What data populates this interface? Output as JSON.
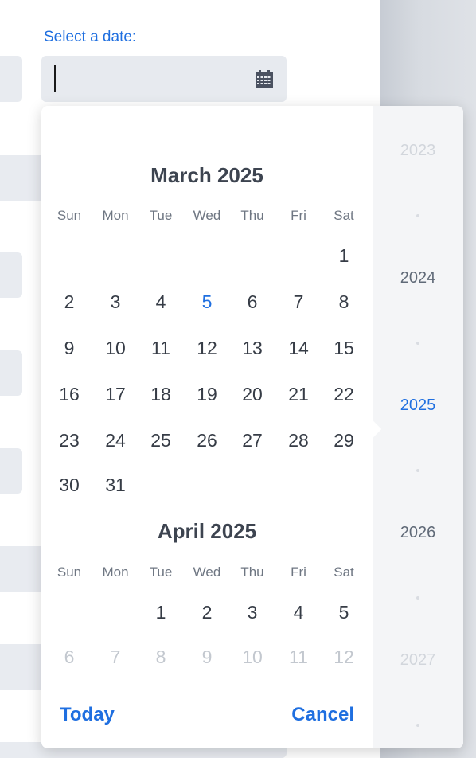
{
  "field": {
    "label": "Select a date:",
    "value": "",
    "icon": "calendar-icon"
  },
  "calendar": {
    "weekdays": [
      "Sun",
      "Mon",
      "Tue",
      "Wed",
      "Thu",
      "Fri",
      "Sat"
    ],
    "months": [
      {
        "title": "March 2025",
        "weeks": [
          [
            "",
            "",
            "",
            "",
            "",
            "",
            "1"
          ],
          [
            "2",
            "3",
            "4",
            "5",
            "6",
            "7",
            "8"
          ],
          [
            "9",
            "10",
            "11",
            "12",
            "13",
            "14",
            "15"
          ],
          [
            "16",
            "17",
            "18",
            "19",
            "20",
            "21",
            "22"
          ],
          [
            "23",
            "24",
            "25",
            "26",
            "27",
            "28",
            "29"
          ],
          [
            "30",
            "31",
            "",
            "",
            "",
            "",
            ""
          ]
        ]
      },
      {
        "title": "April 2025",
        "weeks": [
          [
            "",
            "",
            "1",
            "2",
            "3",
            "4",
            "5"
          ],
          [
            "6",
            "7",
            "8",
            "9",
            "10",
            "11",
            "12"
          ]
        ]
      }
    ],
    "today_date": "5",
    "years": [
      {
        "label": "2023"
      },
      {
        "label": "2024"
      },
      {
        "label": "2025",
        "selected": true
      },
      {
        "label": "2026"
      },
      {
        "label": "2027"
      }
    ],
    "footer": {
      "today_label": "Today",
      "cancel_label": "Cancel"
    }
  },
  "colors": {
    "accent": "#1f6fe0",
    "text": "#363c46",
    "muted": "#c3c8cf",
    "input_bg": "#e7eaef"
  }
}
